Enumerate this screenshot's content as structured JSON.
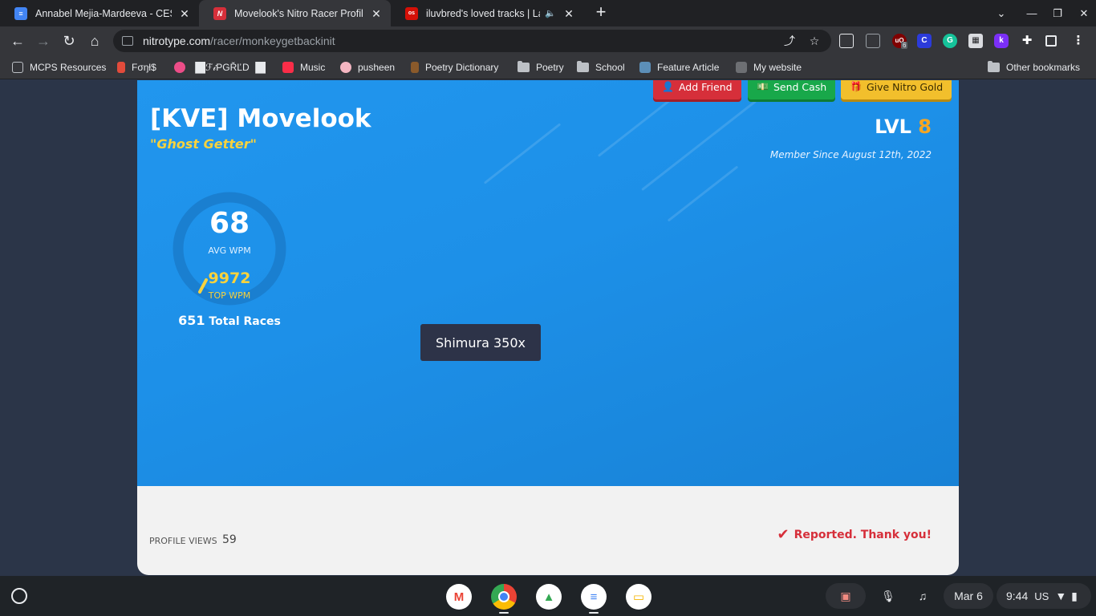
{
  "tabs": [
    {
      "title": "Annabel Mejia-Mardeeva - CES T",
      "favicon": "google-docs-icon",
      "active": false
    },
    {
      "title": "Movelook's Nitro Racer Profile",
      "favicon": "nitro-type-icon",
      "active": true
    },
    {
      "title": "iluvbred's loved tracks | Last",
      "favicon": "lastfm-icon",
      "active": false
    }
  ],
  "address_bar": {
    "domain": "nitrotype.com",
    "path": "/racer/monkeygetbackinit"
  },
  "extensions_badge": "6",
  "bookmarks": [
    {
      "label": "MCPS Resources",
      "icon": "mcps-icon"
    },
    {
      "label": "Fσŋƚ$",
      "icon": "fonts-icon"
    },
    {
      "label": "▐█ℱ𝒾PGŘĽD ▐█",
      "icon": "bookmark-icon"
    },
    {
      "label": "Music",
      "icon": "music-icon"
    },
    {
      "label": "pusheen",
      "icon": "pusheen-icon"
    },
    {
      "label": "Poetry Dictionary",
      "icon": "dictionary-icon"
    },
    {
      "label": "Poetry",
      "icon": "folder-icon"
    },
    {
      "label": "School",
      "icon": "folder-icon"
    },
    {
      "label": "Feature Article",
      "icon": "stack-icon"
    },
    {
      "label": "My website",
      "icon": "cube-icon"
    }
  ],
  "other_bookmarks": "Other bookmarks",
  "profile": {
    "actions": {
      "add_friend": "Add Friend",
      "send_cash": "Send Cash",
      "give_gold": "Give Nitro Gold"
    },
    "name": "[KVE] Movelook",
    "title": "\"Ghost Getter\"",
    "level_label": "LVL",
    "level": "8",
    "member_since": "Member Since August 12th, 2022",
    "avg_wpm": "68",
    "avg_wpm_label": "AVG WPM",
    "top_wpm": "9972",
    "top_wpm_label": "TOP WPM",
    "total_races": "651",
    "total_races_label": "Total Races",
    "car_tooltip": "Shimura 350x",
    "profile_views_label": "PROFILE VIEWS",
    "profile_views": "59",
    "reported": "Reported. Thank you!"
  },
  "shelf": {
    "apps": [
      "gmail-icon",
      "chrome-icon",
      "drive-icon",
      "docs-icon",
      "slides-icon"
    ],
    "date": "Mar 6",
    "time": "9:44",
    "locale": "US"
  },
  "colors": {
    "hero_blue": "#1d90e8",
    "gold": "#f7d23e",
    "level_orange": "#f5a623",
    "red": "#d62f3a",
    "green": "#18a84a"
  }
}
